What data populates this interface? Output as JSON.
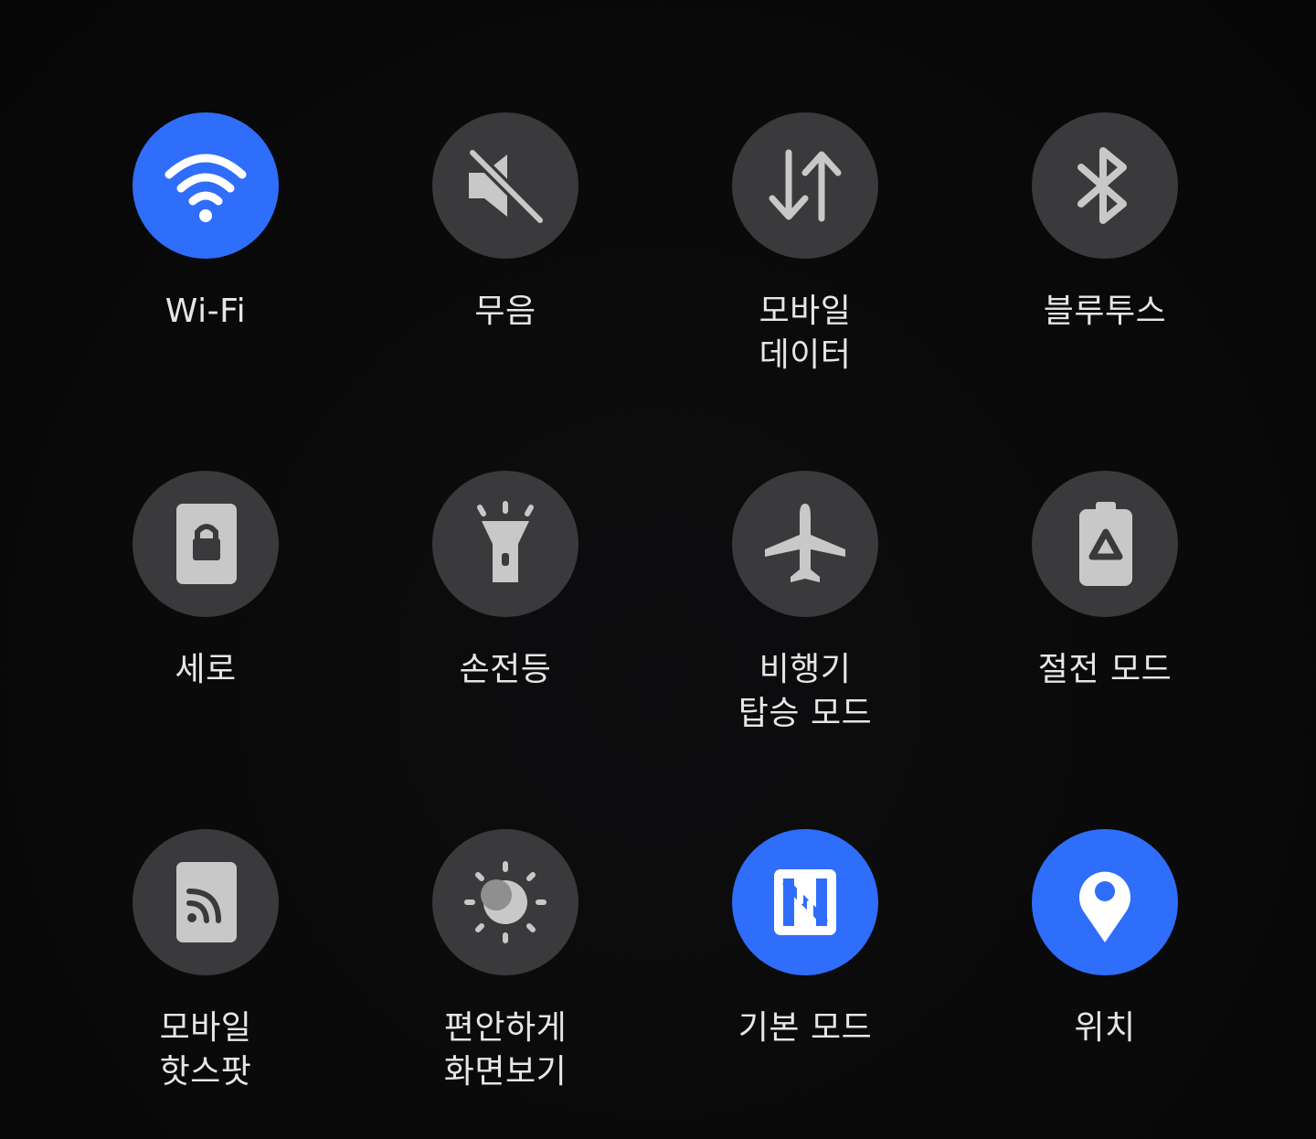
{
  "tiles": [
    {
      "label": "Wi-Fi",
      "icon": "wifi-icon",
      "state": "on"
    },
    {
      "label": "무음",
      "icon": "mute-icon",
      "state": "off"
    },
    {
      "label": "모바일\n데이터",
      "icon": "mobile-data-icon",
      "state": "off"
    },
    {
      "label": "블루투스",
      "icon": "bluetooth-icon",
      "state": "off"
    },
    {
      "label": "세로",
      "icon": "portrait-lock-icon",
      "state": "off"
    },
    {
      "label": "손전등",
      "icon": "flashlight-icon",
      "state": "off"
    },
    {
      "label": "비행기\n탑승 모드",
      "icon": "airplane-icon",
      "state": "off"
    },
    {
      "label": "절전 모드",
      "icon": "power-saving-icon",
      "state": "off"
    },
    {
      "label": "모바일\n핫스팟",
      "icon": "hotspot-icon",
      "state": "off"
    },
    {
      "label": "편안하게\n화면보기",
      "icon": "eye-comfort-icon",
      "state": "off"
    },
    {
      "label": "기본 모드",
      "icon": "nfc-icon",
      "state": "on"
    },
    {
      "label": "위치",
      "icon": "location-icon",
      "state": "on"
    }
  ],
  "colors": {
    "active": "#2f6dfb",
    "inactive": "#3a3a3c",
    "icon_inactive": "#c8c8c8",
    "icon_active": "#ffffff",
    "label": "#e6e6e6",
    "background": "#0a0a0a"
  }
}
